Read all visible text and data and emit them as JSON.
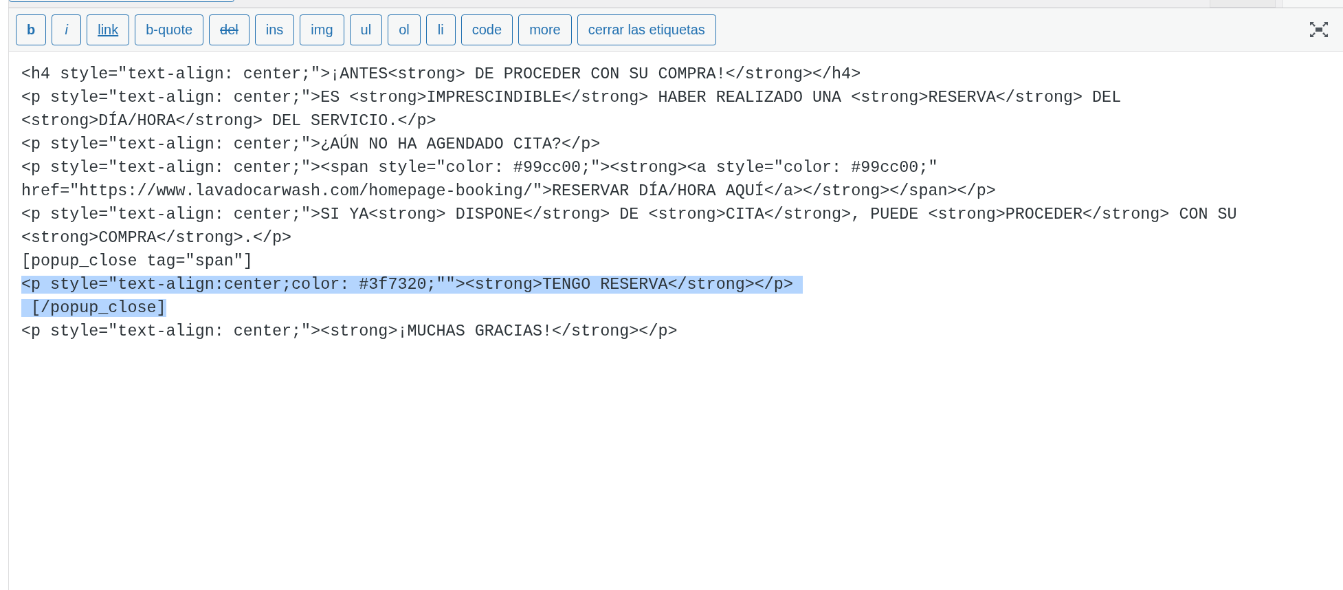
{
  "toolbar": {
    "buttons": [
      {
        "label": "b",
        "kind": "bold"
      },
      {
        "label": "i",
        "kind": "italic"
      },
      {
        "label": "link",
        "kind": "link"
      },
      {
        "label": "b-quote",
        "kind": "plain"
      },
      {
        "label": "del",
        "kind": "strike"
      },
      {
        "label": "ins",
        "kind": "plain"
      },
      {
        "label": "img",
        "kind": "plain"
      },
      {
        "label": "ul",
        "kind": "plain"
      },
      {
        "label": "ol",
        "kind": "plain"
      },
      {
        "label": "li",
        "kind": "plain"
      },
      {
        "label": "code",
        "kind": "plain"
      },
      {
        "label": "more",
        "kind": "plain"
      },
      {
        "label": "cerrar las etiquetas",
        "kind": "plain"
      }
    ]
  },
  "editor": {
    "lines": [
      {
        "text": "<h4 style=\"text-align: center;\">¡ANTES<strong> DE PROCEDER CON SU COMPRA!</strong></h4>",
        "selected": false
      },
      {
        "text": "<p style=\"text-align: center;\">ES <strong>IMPRESCINDIBLE</strong> HABER REALIZADO UNA <strong>RESERVA</strong> DEL",
        "selected": false
      },
      {
        "text": "<strong>DÍA/HORA</strong> DEL SERVICIO.</p>",
        "selected": false
      },
      {
        "text": "<p style=\"text-align: center;\">¿AÚN NO HA AGENDADO CITA?</p>",
        "selected": false
      },
      {
        "text": "<p style=\"text-align: center;\"><span style=\"color: #99cc00;\"><strong><a style=\"color: #99cc00;\"",
        "selected": false
      },
      {
        "text": "href=\"https://www.lavadocarwash.com/homepage-booking/\">RESERVAR DÍA/HORA AQUÍ</a></strong></span></p>",
        "selected": false
      },
      {
        "text": "<p style=\"text-align: center;\">SI YA<strong> DISPONE</strong> DE <strong>CITA</strong>, PUEDE <strong>PROCEDER</strong> CON SU",
        "selected": false
      },
      {
        "text": "<strong>COMPRA</strong>.</p>",
        "selected": false
      },
      {
        "text": "[popup_close tag=\"span\"]",
        "selected": false
      },
      {
        "text": "<p style=\"text-align:center;color: #3f7320;\"\"><strong>TENGO RESERVA</strong></p> ",
        "selected": true
      },
      {
        "text": " [/popup_close]",
        "selected": true
      },
      {
        "text": "<p style=\"text-align: center;\"><strong>¡MUCHAS GRACIAS!</strong></p>",
        "selected": false
      }
    ]
  }
}
